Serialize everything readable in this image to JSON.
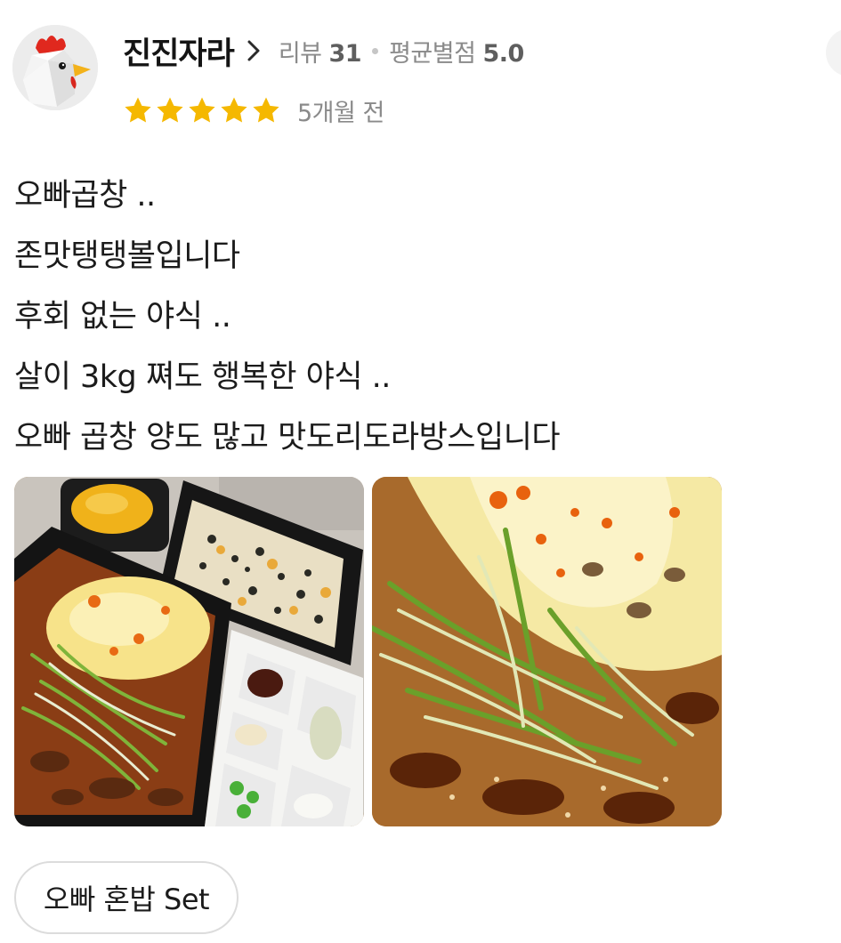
{
  "reviewer": {
    "nickname": "진진자라",
    "review_count_label": "리뷰",
    "review_count": "31",
    "avg_rating_label": "평균별점",
    "avg_rating": "5.0",
    "avatar_icon": "chicken-avatar-icon"
  },
  "rating": {
    "stars": 5,
    "max_stars": 5,
    "star_color": "#f5b800",
    "time_ago": "5개월 전"
  },
  "review": {
    "lines": [
      "오빠곱창 ..",
      "존맛탱탱볼입니다",
      "후회 없는 야식 ..",
      "살이 3kg 쪄도 행복한 야식 ..",
      "오빠 곱창 양도 많고 맛도리도라방스입니다"
    ]
  },
  "photos": {
    "count": 2
  },
  "menu": {
    "ordered_item": "오빠 혼밥 Set"
  }
}
